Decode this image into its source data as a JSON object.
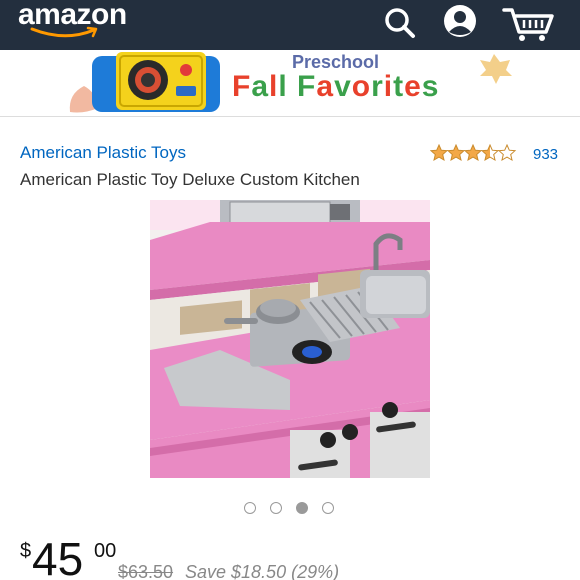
{
  "header": {
    "logo_text": "amazon",
    "icons": [
      "search-icon",
      "account-icon",
      "cart-icon"
    ],
    "background_color": "#232f3e",
    "smile_color": "#ff9900"
  },
  "banner": {
    "subtitle": "Preschool",
    "title": "Fall Favorites"
  },
  "product": {
    "brand": "American Plastic Toys",
    "title": "American Plastic Toy Deluxe Custom Kitchen",
    "rating": 3.5,
    "rating_count": "933",
    "carousel": {
      "total": 4,
      "active_index": 2
    }
  },
  "price": {
    "currency": "$",
    "whole": "45",
    "fraction": "00",
    "list_price": "$63.50",
    "savings": "Save $18.50 (29%)"
  },
  "colors": {
    "link": "#0066c0",
    "star": "#f3a847",
    "kitchen_pink": "#e98ac3"
  }
}
